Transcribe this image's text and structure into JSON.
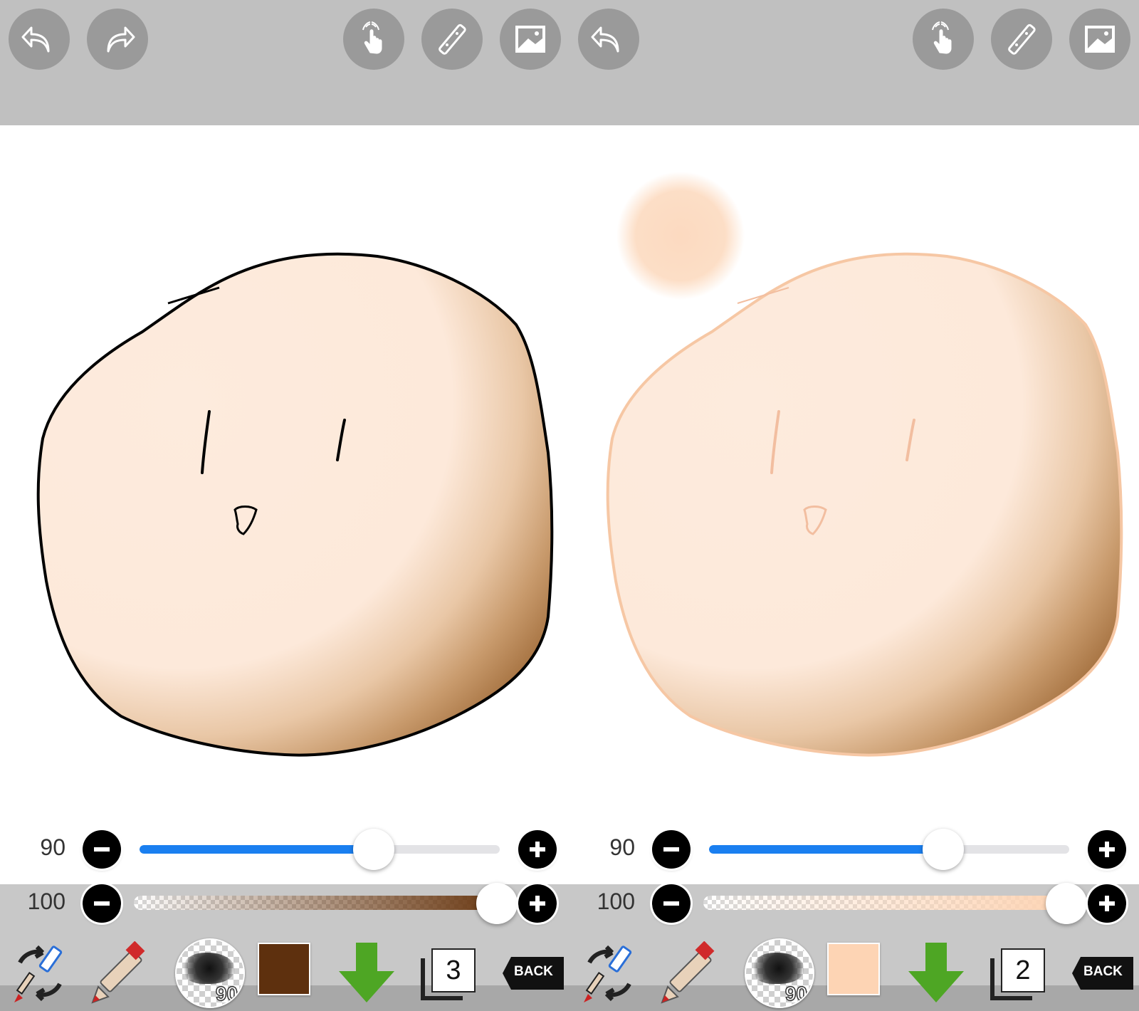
{
  "panels": [
    {
      "brush_size": "90",
      "brush_size_fraction": 0.65,
      "opacity": "100",
      "opacity_fraction": 1.0,
      "brush_preview_label": "90",
      "color": "#5e300e",
      "opacity_gradient_color": "#6b3a14",
      "layer_number": "3",
      "back_label": "BACK",
      "line_color": "#000000"
    },
    {
      "brush_size": "90",
      "brush_size_fraction": 0.65,
      "opacity": "100",
      "opacity_fraction": 1.0,
      "brush_preview_label": "90",
      "color": "#fdd4b4",
      "opacity_gradient_color": "#fdd4b4",
      "layer_number": "2",
      "back_label": "BACK",
      "line_color": "#f6c7a4"
    }
  ],
  "colors": {
    "skin_fill": "#fdebdd",
    "shade": "#b98958",
    "accent_blue": "#1a7ff0",
    "toolbar_gray": "#c0c0c0",
    "button_gray": "#9a9a9a"
  },
  "toolbar_icons": [
    "undo-icon",
    "redo-icon",
    "hand-touch-icon",
    "ruler-icon",
    "image-icon",
    "undo-icon",
    "hand-touch-icon",
    "ruler-icon",
    "image-icon"
  ]
}
